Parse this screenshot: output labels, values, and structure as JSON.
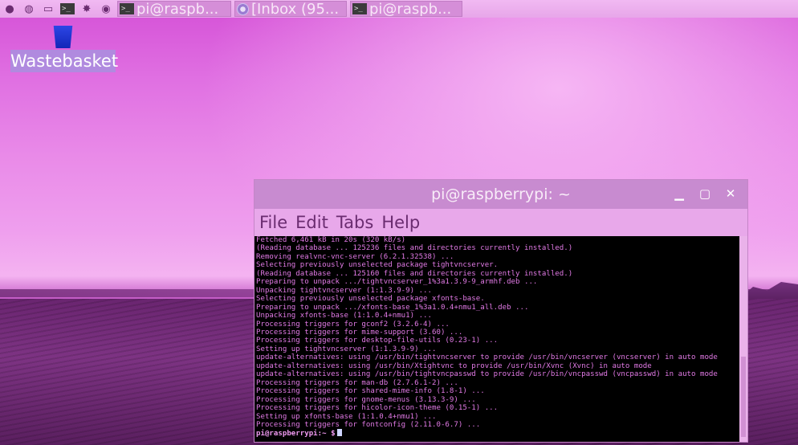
{
  "taskbar": {
    "tasks": [
      {
        "label": "pi@raspb...",
        "icon": "terminal-icon"
      },
      {
        "label": "[Inbox (95...",
        "icon": "chromium-icon"
      },
      {
        "label": "pi@raspb...",
        "icon": "terminal-icon"
      }
    ],
    "launchers": [
      "raspberry-menu-icon",
      "web-browser-icon",
      "file-manager-icon",
      "terminal-icon",
      "mathematica-icon",
      "wolfram-icon"
    ]
  },
  "desktop": {
    "wastebasket_label": "Wastebasket"
  },
  "terminal_window": {
    "title": "pi@raspberrypi: ~",
    "menu": [
      "File",
      "Edit",
      "Tabs",
      "Help"
    ],
    "lines": [
      "Fetched 6,461 kB in 20s (320 kB/s)",
      "(Reading database ... 125236 files and directories currently installed.)",
      "Removing realvnc-vnc-server (6.2.1.32538) ...",
      "Selecting previously unselected package tightvncserver.",
      "(Reading database ... 125160 files and directories currently installed.)",
      "Preparing to unpack .../tightvncserver_1%3a1.3.9-9_armhf.deb ...",
      "Unpacking tightvncserver (1:1.3.9-9) ...",
      "Selecting previously unselected package xfonts-base.",
      "Preparing to unpack .../xfonts-base_1%3a1.0.4+nmu1_all.deb ...",
      "Unpacking xfonts-base (1:1.0.4+nmu1) ...",
      "Processing triggers for gconf2 (3.2.6-4) ...",
      "Processing triggers for mime-support (3.60) ...",
      "Processing triggers for desktop-file-utils (0.23-1) ...",
      "Setting up tightvncserver (1:1.3.9-9) ...",
      "update-alternatives: using /usr/bin/tightvncserver to provide /usr/bin/vncserver (vncserver) in auto mode",
      "update-alternatives: using /usr/bin/Xtightvnc to provide /usr/bin/Xvnc (Xvnc) in auto mode",
      "update-alternatives: using /usr/bin/tightvncpasswd to provide /usr/bin/vncpasswd (vncpasswd) in auto mode",
      "Processing triggers for man-db (2.7.6.1-2) ...",
      "Processing triggers for shared-mime-info (1.8-1) ...",
      "Processing triggers for gnome-menus (3.13.3-9) ...",
      "Processing triggers for hicolor-icon-theme (0.15-1) ...",
      "Setting up xfonts-base (1:1.0.4+nmu1) ...",
      "Processing triggers for fontconfig (2.11.0-6.7) ..."
    ],
    "prompt": "pi@raspberrypi:~ $"
  },
  "colors": {
    "terminal_text": "#e27ae6",
    "terminal_bg": "#000000",
    "titlebar": "#c88bd0"
  }
}
